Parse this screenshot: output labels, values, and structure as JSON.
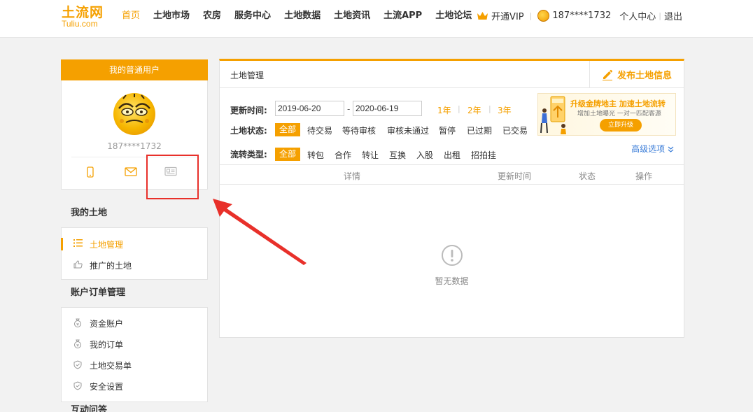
{
  "header": {
    "logo_cn": "土流网",
    "logo_en": "Tuliu.com",
    "nav": [
      "首页",
      "土地市场",
      "农房",
      "服务中心",
      "土地数据",
      "土地资讯",
      "土流APP",
      "土地论坛"
    ],
    "vip": "开通VIP",
    "user": "187****1732",
    "center": "个人中心",
    "logout": "退出"
  },
  "sidebar": {
    "user_box_title": "我的普通用户",
    "username": "187****1732",
    "section_land": "我的土地",
    "land_items": [
      "土地管理",
      "推广的土地"
    ],
    "section_account": "账户订单管理",
    "account_items": [
      "资金账户",
      "我的订单",
      "土地交易单",
      "安全设置"
    ],
    "section_interact": "互动问答"
  },
  "main": {
    "title": "土地管理",
    "publish": "发布土地信息",
    "update_time_label": "更新时间:",
    "date_from": "2019-06-20",
    "date_to": "2020-06-19",
    "dash": "-",
    "years": [
      "1年",
      "2年",
      "3年"
    ],
    "status_label": "土地状态:",
    "status_options": [
      "全部",
      "待交易",
      "等待审核",
      "审核未通过",
      "暂停",
      "已过期",
      "已交易"
    ],
    "type_label": "流转类型:",
    "type_options": [
      "全部",
      "转包",
      "合作",
      "转让",
      "互换",
      "入股",
      "出租",
      "招拍挂"
    ],
    "advanced": "高级选项",
    "columns": [
      "详情",
      "更新时间",
      "状态",
      "操作"
    ],
    "empty": "暂无数据"
  },
  "banner": {
    "title": "升级金牌地主  加速土地流转",
    "subtitle": "增加土地曝光  一对一匹配客源",
    "button": "立即升级"
  },
  "colors": {
    "accent": "#f5a000",
    "link": "#3b7dd8",
    "annotation": "#e8302a"
  }
}
